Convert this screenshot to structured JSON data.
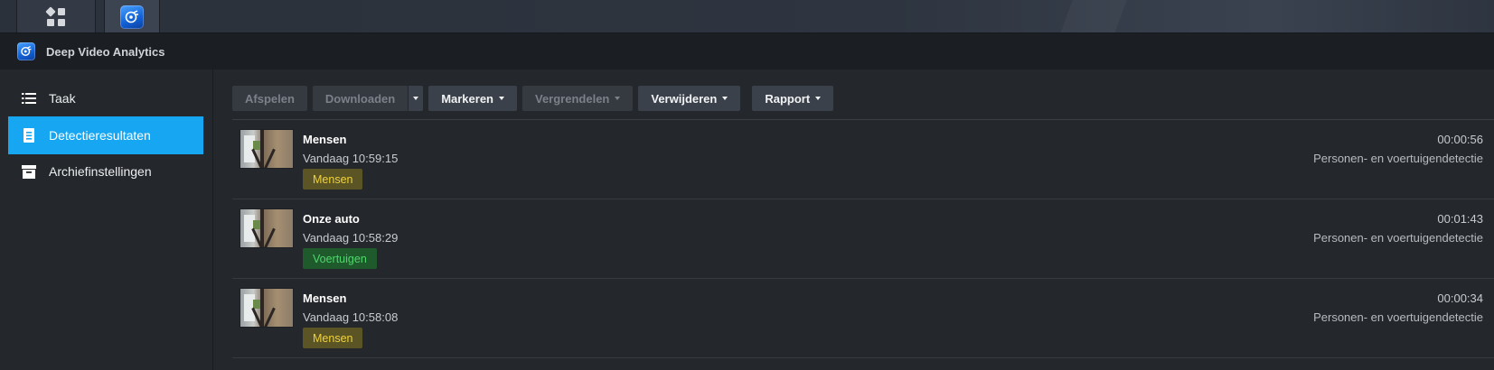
{
  "app": {
    "title": "Deep Video Analytics"
  },
  "taskbar": {
    "main_menu_icon": "apps-grid-icon",
    "app_icon": "deep-video-analytics-icon"
  },
  "sidebar": {
    "items": [
      {
        "label": "Taak",
        "icon": "list-icon",
        "active": false
      },
      {
        "label": "Detectieresultaten",
        "icon": "document-icon",
        "active": true
      },
      {
        "label": "Archiefinstellingen",
        "icon": "archive-icon",
        "active": false
      }
    ]
  },
  "toolbar": {
    "play": "Afspelen",
    "download": "Downloaden",
    "mark": "Markeren",
    "lock": "Vergrendelen",
    "delete": "Verwijderen",
    "report": "Rapport"
  },
  "results": [
    {
      "name": "Mensen",
      "time": "Vandaag 10:59:15",
      "tag": "Mensen",
      "tag_type": "people",
      "duration": "00:00:56",
      "detection": "Personen- en voertuigendetectie"
    },
    {
      "name": "Onze auto",
      "time": "Vandaag 10:58:29",
      "tag": "Voertuigen",
      "tag_type": "vehicle",
      "duration": "00:01:43",
      "detection": "Personen- en voertuigendetectie"
    },
    {
      "name": "Mensen",
      "time": "Vandaag 10:58:08",
      "tag": "Mensen",
      "tag_type": "people",
      "duration": "00:00:34",
      "detection": "Personen- en voertuigendetectie"
    }
  ],
  "colors": {
    "accent": "#16a6f2",
    "people_tag": "#f0d23a",
    "vehicle_tag": "#4fd66b"
  }
}
